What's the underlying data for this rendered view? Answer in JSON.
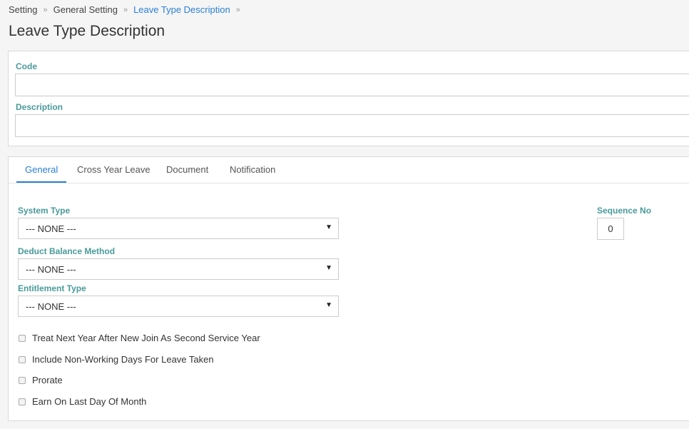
{
  "breadcrumb": {
    "items": [
      "Setting",
      "General Setting",
      "Leave Type Description"
    ],
    "separator": "»"
  },
  "page": {
    "title": "Leave Type Description"
  },
  "form": {
    "code_label": "Code",
    "code_value": "",
    "description_label": "Description",
    "description_value": ""
  },
  "tabs": [
    {
      "label": "General",
      "active": true
    },
    {
      "label": "Cross Year Leave",
      "active": false
    },
    {
      "label": "Document",
      "active": false
    },
    {
      "label": "Notification",
      "active": false
    }
  ],
  "general": {
    "system_type_label": "System Type",
    "system_type_value": "--- NONE ---",
    "deduct_balance_label": "Deduct Balance Method",
    "deduct_balance_value": "--- NONE ---",
    "entitlement_type_label": "Entitlement Type",
    "entitlement_type_value": "--- NONE ---",
    "sequence_label": "Sequence No",
    "sequence_value": "0",
    "checkboxes": [
      {
        "label": "Treat Next Year After New Join As Second Service Year",
        "checked": false
      },
      {
        "label": "Include Non-Working Days For Leave Taken",
        "checked": false
      },
      {
        "label": "Prorate",
        "checked": false
      },
      {
        "label": "Earn On Last Day Of Month",
        "checked": false
      }
    ]
  },
  "icons": {
    "caret": "caret-down-icon",
    "separator": "double-chevron-right-icon"
  },
  "colors": {
    "accent": "#2a7fd4",
    "label": "#4a9a9a"
  }
}
